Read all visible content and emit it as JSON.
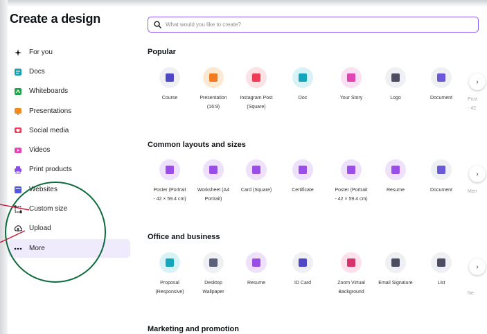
{
  "sidebar": {
    "title": "Create a design",
    "items": [
      {
        "label": "For you",
        "icon": "sparkle-icon",
        "color": "#0e1318"
      },
      {
        "label": "Docs",
        "icon": "docs-icon",
        "color": "#13a3b5"
      },
      {
        "label": "Whiteboards",
        "icon": "whiteboard-icon",
        "color": "#1ea446"
      },
      {
        "label": "Presentations",
        "icon": "presentation-icon",
        "color": "#f38b1e"
      },
      {
        "label": "Social media",
        "icon": "heart-icon",
        "color": "#ef3b55"
      },
      {
        "label": "Videos",
        "icon": "video-icon",
        "color": "#e442b8"
      },
      {
        "label": "Print products",
        "icon": "printer-icon",
        "color": "#8a4fe8"
      },
      {
        "label": "Websites",
        "icon": "website-icon",
        "color": "#5056e0"
      },
      {
        "label": "Custom size",
        "icon": "custom-size-icon",
        "color": "#0e1318"
      },
      {
        "label": "Upload",
        "icon": "upload-icon",
        "color": "#0e1318"
      },
      {
        "label": "More",
        "icon": "more-icon",
        "color": "#0e1318"
      }
    ]
  },
  "search": {
    "placeholder": "What would you like to create?"
  },
  "sections": [
    {
      "title": "Popular",
      "items": [
        {
          "line1": "Course",
          "line2": "",
          "circle": "#eef0f4",
          "glyph": "#4f46c8"
        },
        {
          "line1": "Presentation",
          "line2": "(16:9)",
          "circle": "#fde8d2",
          "glyph": "#f37a1e"
        },
        {
          "line1": "Instagram Post",
          "line2": "(Square)",
          "circle": "#fde1e4",
          "glyph": "#ef3b55"
        },
        {
          "line1": "Doc",
          "line2": "",
          "circle": "#d8f3f7",
          "glyph": "#14a7bc"
        },
        {
          "line1": "Your Story",
          "line2": "",
          "circle": "#fbe0f4",
          "glyph": "#e144b5"
        },
        {
          "line1": "Logo",
          "line2": "",
          "circle": "#eef0f4",
          "glyph": "#4c4c63"
        },
        {
          "line1": "Document",
          "line2": "",
          "circle": "#eef0f4",
          "glyph": "#6a5ad8"
        }
      ],
      "cut_top": "Post",
      "cut_bottom": "- 42"
    },
    {
      "title": "Common layouts and sizes",
      "items": [
        {
          "line1": "Poster (Portrait",
          "line2": "- 42 × 59.4 cm)",
          "circle": "#efe0fb",
          "glyph": "#9b4de8"
        },
        {
          "line1": "Worksheet (A4",
          "line2": "Portrait)",
          "circle": "#efe0fb",
          "glyph": "#9b4de8"
        },
        {
          "line1": "Card (Square)",
          "line2": "",
          "circle": "#efe0fb",
          "glyph": "#9b4de8"
        },
        {
          "line1": "Certificate",
          "line2": "",
          "circle": "#efe0fb",
          "glyph": "#9b4de8"
        },
        {
          "line1": "Poster (Portrait",
          "line2": "- 42 × 59.4 cm)",
          "circle": "#efe0fb",
          "glyph": "#9b4de8"
        },
        {
          "line1": "Resume",
          "line2": "",
          "circle": "#efe0fb",
          "glyph": "#9b4de8"
        },
        {
          "line1": "Document",
          "line2": "",
          "circle": "#eef0f4",
          "glyph": "#6a5ad8"
        }
      ],
      "cut_top": "Men",
      "cut_bottom": ""
    },
    {
      "title": "Office and business",
      "items": [
        {
          "line1": "Proposal",
          "line2": "(Responsive)",
          "circle": "#d8f3f7",
          "glyph": "#14a7bc"
        },
        {
          "line1": "Desktop",
          "line2": "Wallpaper",
          "circle": "#eef0f4",
          "glyph": "#5a5f7a"
        },
        {
          "line1": "Resume",
          "line2": "",
          "circle": "#efe0fb",
          "glyph": "#9b4de8"
        },
        {
          "line1": "ID Card",
          "line2": "",
          "circle": "#eef0f4",
          "glyph": "#4f46c8"
        },
        {
          "line1": "Zoom Virtual",
          "line2": "Background",
          "circle": "#fde1ec",
          "glyph": "#d8336a"
        },
        {
          "line1": "Email Signature",
          "line2": "",
          "circle": "#eef0f4",
          "glyph": "#4c4c63"
        },
        {
          "line1": "List",
          "line2": "",
          "circle": "#eef0f4",
          "glyph": "#4c4c63"
        }
      ],
      "cut_top": "",
      "cut_bottom": "Ne"
    },
    {
      "title": "Marketing and promotion",
      "items": []
    }
  ],
  "next_arrow": "›",
  "colors": {
    "accent": "#8b5cf6",
    "annotation": "#0b6b3a",
    "pointer": "#c81e3c"
  }
}
